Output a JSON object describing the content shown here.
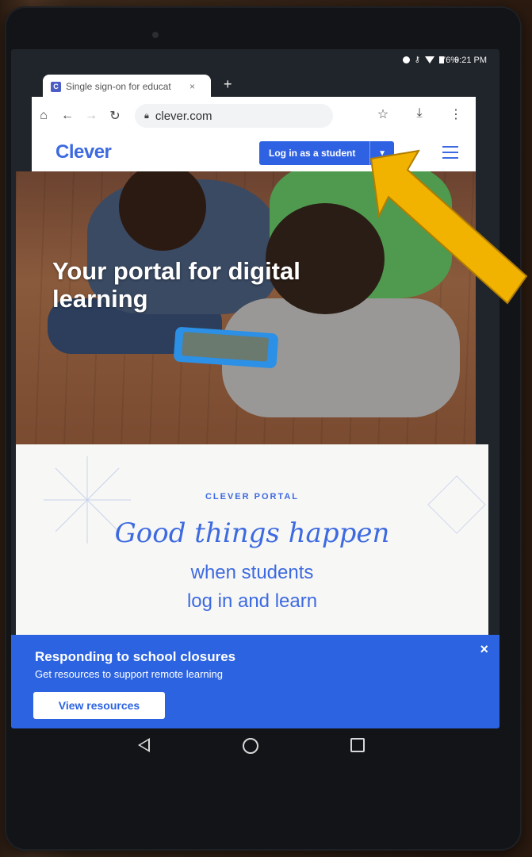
{
  "status_bar": {
    "battery": "76%",
    "time": "9:21 PM"
  },
  "browser": {
    "tab_title": "Single sign-on for educat",
    "tab_close": "×",
    "new_tab": "+",
    "url": "clever.com"
  },
  "site": {
    "logo": "Clever",
    "login_label": "Log in as a student"
  },
  "hero": {
    "title": "Your portal for digital learning"
  },
  "portal": {
    "eyebrow": "CLEVER PORTAL",
    "script_line": "Good things happen",
    "line1": "when students",
    "line2": "log in and learn"
  },
  "banner": {
    "title": "Responding to school closures",
    "subtitle": "Get resources to support remote learning",
    "button": "View resources",
    "close": "×"
  },
  "colors": {
    "brand_blue": "#2f62e3",
    "annotation_arrow": "#f2b300"
  }
}
